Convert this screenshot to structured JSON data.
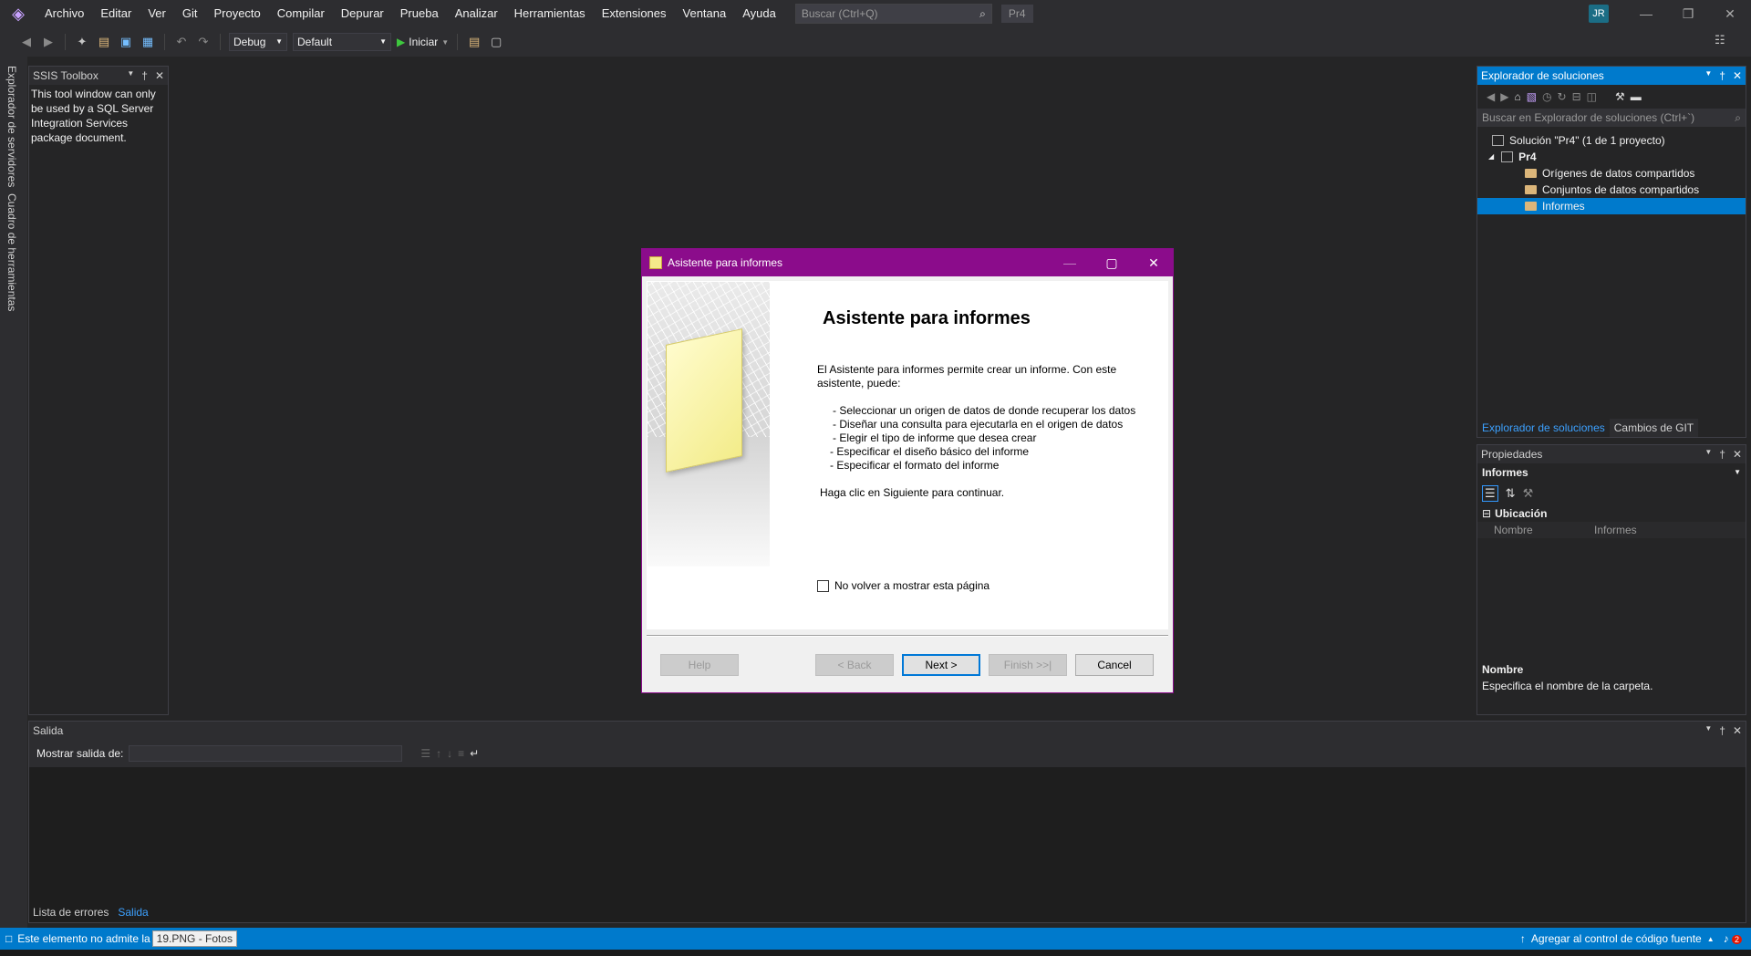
{
  "menubar": {
    "items": [
      "Archivo",
      "Editar",
      "Ver",
      "Git",
      "Proyecto",
      "Compilar",
      "Depurar",
      "Prueba",
      "Analizar",
      "Herramientas",
      "Extensiones",
      "Ventana",
      "Ayuda"
    ],
    "search_placeholder": "Buscar (Ctrl+Q)",
    "solution_name": "Pr4",
    "user_initials": "JR"
  },
  "toolbar": {
    "config": "Debug",
    "platform": "Default",
    "start_label": "Iniciar"
  },
  "left_strip": {
    "tab1": "Explorador de servidores",
    "tab2": "Cuadro de herramientas"
  },
  "ssis": {
    "title": "SSIS Toolbox",
    "text": "This tool window can only be used by a SQL Server Integration Services package document."
  },
  "dialog": {
    "title": "Asistente para informes",
    "heading": "Asistente para informes",
    "intro": "El Asistente para informes permite crear un informe. Con este asistente, puede:",
    "list": [
      "- Seleccionar un origen de datos de donde recuperar los datos",
      "- Diseñar una consulta para ejecutarla en el origen de datos",
      "- Elegir el tipo de informe que desea crear",
      "- Especificar el diseño básico del informe",
      "- Especificar el formato del informe"
    ],
    "continue": "Haga clic en Siguiente para continuar.",
    "checkbox_label": "No volver a mostrar esta página",
    "buttons": {
      "help": "Help",
      "back": "< Back",
      "next": "Next >",
      "finish": "Finish >>|",
      "cancel": "Cancel"
    }
  },
  "solution_explorer": {
    "title": "Explorador de soluciones",
    "search_placeholder": "Buscar en Explorador de soluciones (Ctrl+`)",
    "solution": "Solución \"Pr4\" (1 de 1 proyecto)",
    "project": "Pr4",
    "folders": [
      "Orígenes de datos compartidos",
      "Conjuntos de datos compartidos",
      "Informes"
    ],
    "selected_folder": "Informes",
    "tabs": [
      "Explorador de soluciones",
      "Cambios de GIT"
    ]
  },
  "properties": {
    "title": "Propiedades",
    "object": "Informes",
    "category": "Ubicación",
    "row_key": "Nombre",
    "row_value": "Informes",
    "desc_title": "Nombre",
    "desc_text": "Especifica el nombre de la carpeta."
  },
  "output": {
    "title": "Salida",
    "show_from_label": "Mostrar salida de:",
    "tabs": [
      "Lista de errores",
      "Salida"
    ]
  },
  "statusbar": {
    "message": "Este elemento no admite la",
    "tooltip": "19.PNG - Fotos",
    "source_control": "Agregar al control de código fuente",
    "notifications": "2"
  },
  "colors": {
    "accent": "#007acc",
    "dialog_titlebar": "#8b0c8b",
    "background": "#252526"
  }
}
